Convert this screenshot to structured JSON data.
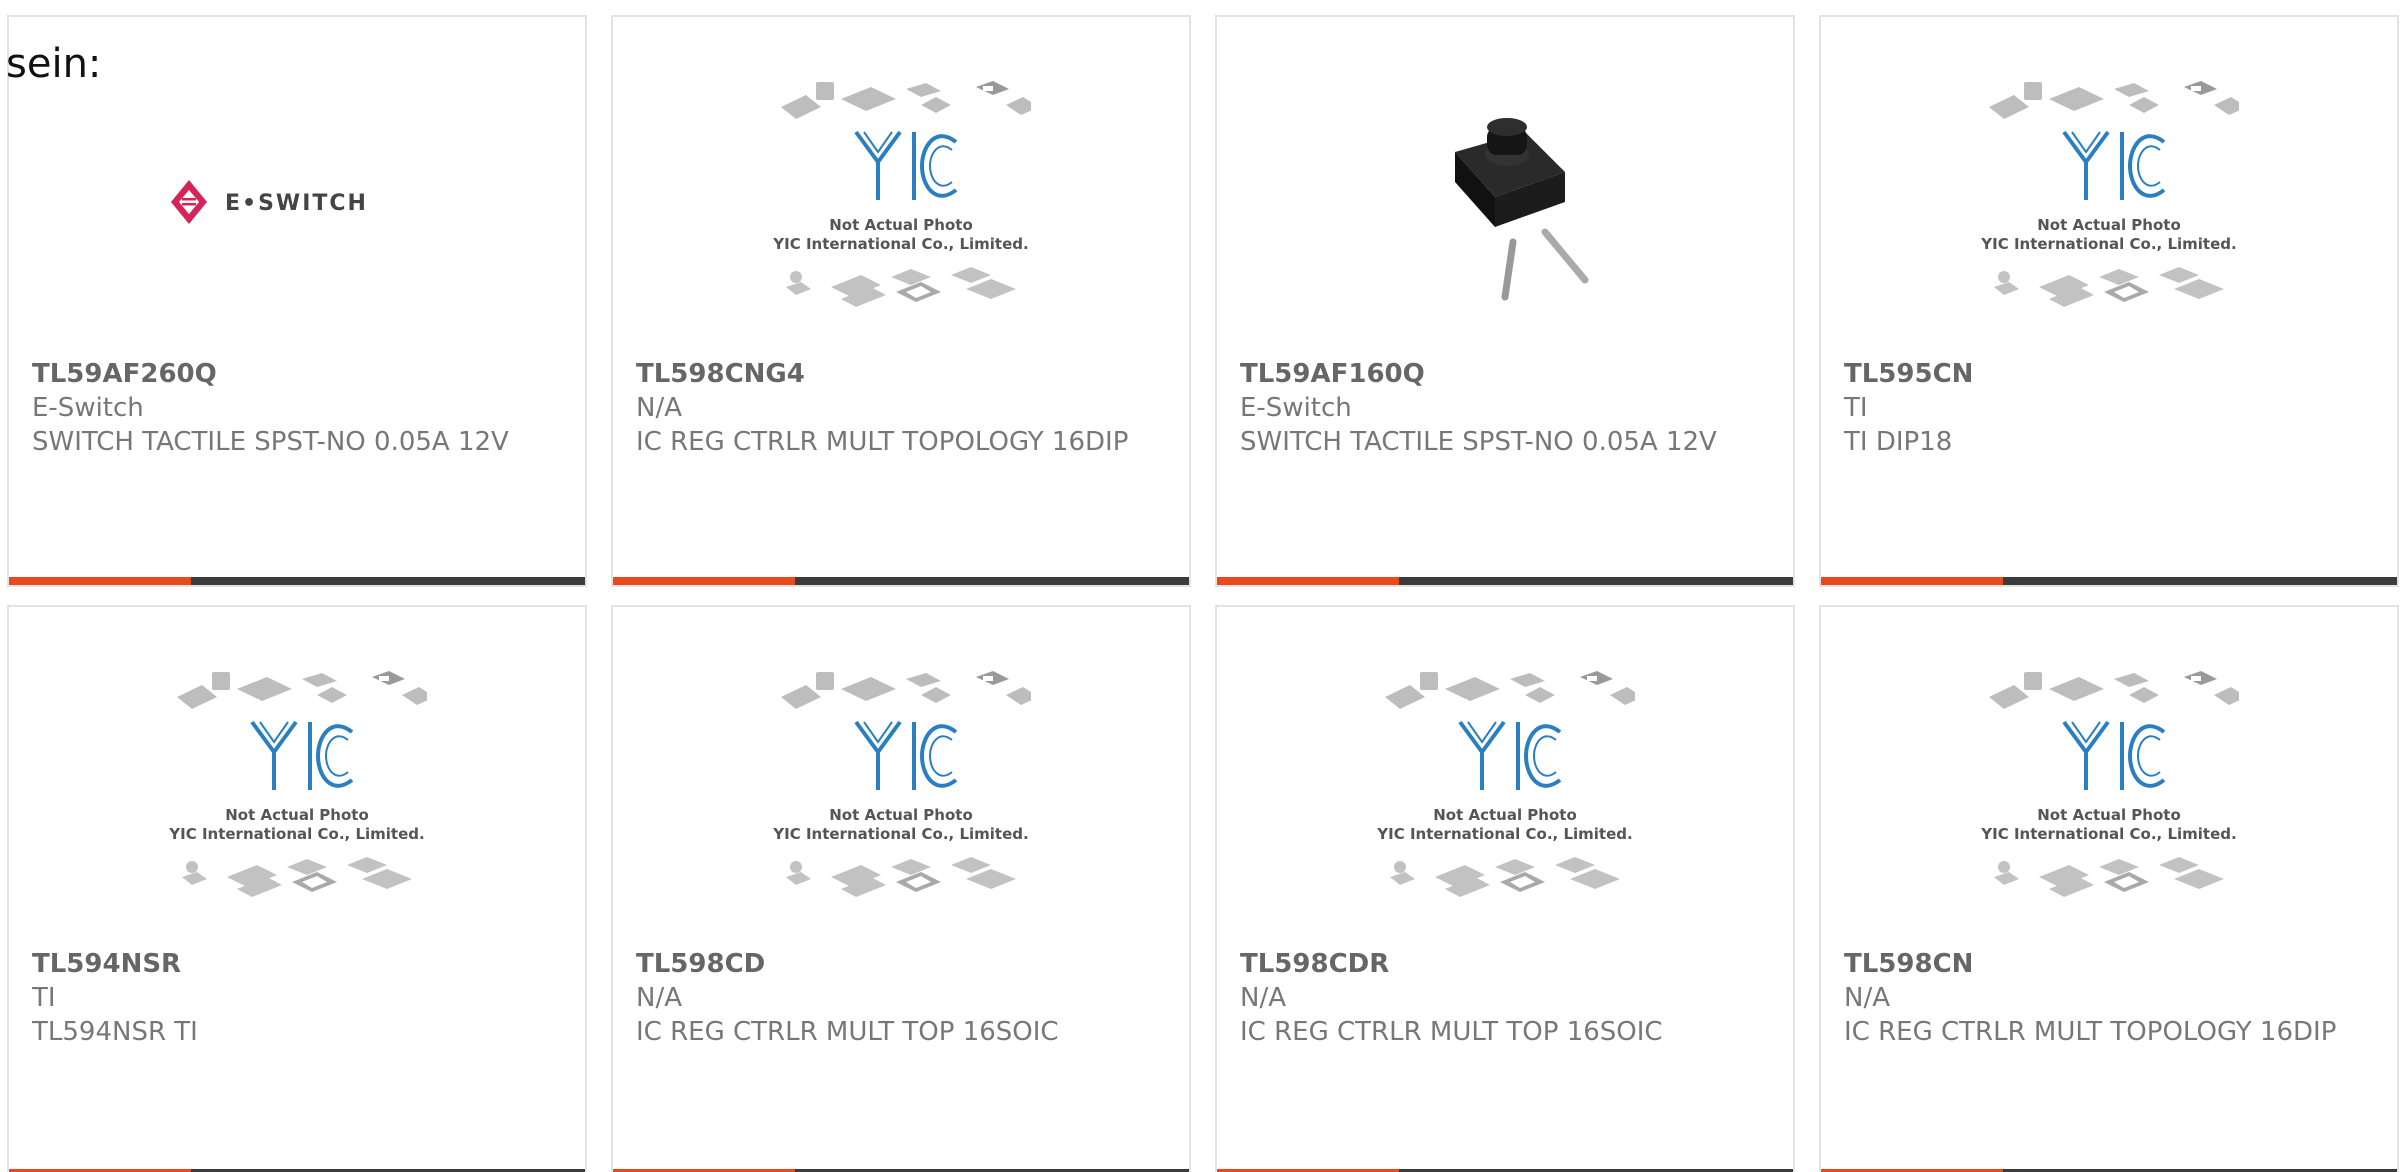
{
  "intro_text": "sein:",
  "colors": {
    "accent": "#e84a1c",
    "bar": "#3b3b3b",
    "border": "#e3e3e3",
    "text": "#777777"
  },
  "placeholder": {
    "line1": "Not Actual Photo",
    "line2": "YIC International Co., Limited.",
    "logo": "YIC"
  },
  "eswitch_logo": "E•SWITCH",
  "products": [
    {
      "pn": "TL59AF260Q",
      "mfr": "E-Switch",
      "desc": "SWITCH TACTILE SPST-NO 0.05A 12V",
      "image": "eswitch-logo"
    },
    {
      "pn": "TL598CNG4",
      "mfr": "N/A",
      "desc": "IC REG CTRLR MULT TOPOLOGY 16DIP",
      "image": "placeholder"
    },
    {
      "pn": "TL59AF160Q",
      "mfr": "E-Switch",
      "desc": "SWITCH TACTILE SPST-NO 0.05A 12V",
      "image": "tactile-switch-photo"
    },
    {
      "pn": "TL595CN",
      "mfr": "TI",
      "desc": "TI DIP18",
      "image": "placeholder"
    },
    {
      "pn": "TL594NSR",
      "mfr": "TI",
      "desc": "TL594NSR TI",
      "image": "placeholder"
    },
    {
      "pn": "TL598CD",
      "mfr": "N/A",
      "desc": "IC REG CTRLR MULT TOP 16SOIC",
      "image": "placeholder"
    },
    {
      "pn": "TL598CDR",
      "mfr": "N/A",
      "desc": "IC REG CTRLR MULT TOP 16SOIC",
      "image": "placeholder"
    },
    {
      "pn": "TL598CN",
      "mfr": "N/A",
      "desc": "IC REG CTRLR MULT TOPOLOGY 16DIP",
      "image": "placeholder"
    }
  ]
}
